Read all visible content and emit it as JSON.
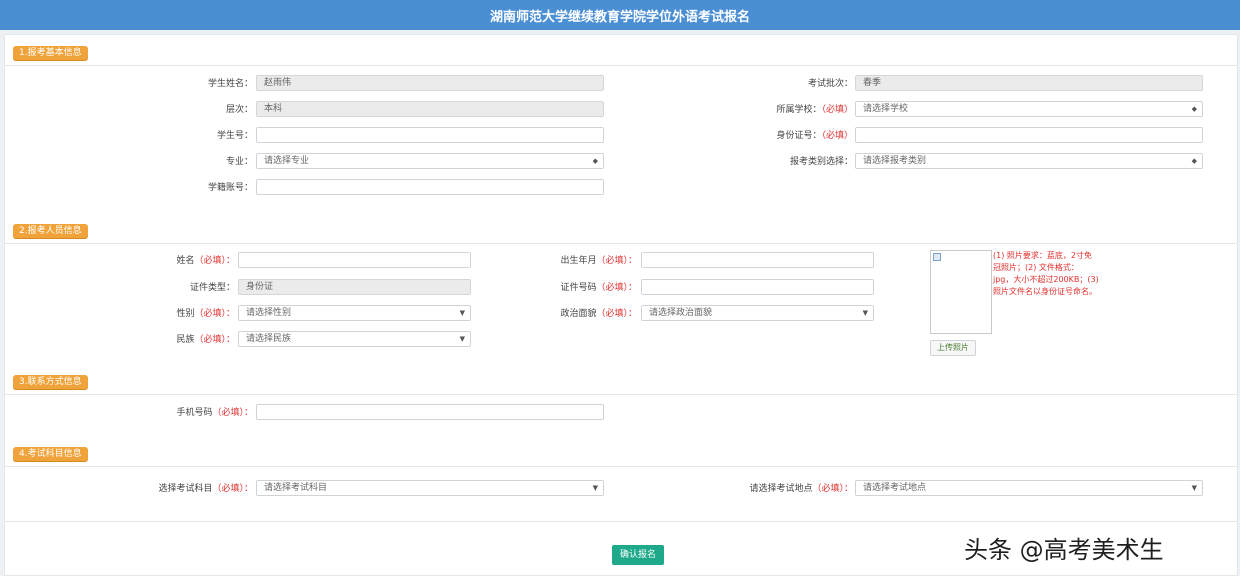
{
  "header": {
    "title": "湖南师范大学继续教育学院学位外语考试报名"
  },
  "sections": {
    "basic": "1.报考基本信息",
    "personal": "2.报考人员信息",
    "contact": "3.联系方式信息",
    "exam": "4.考试科目信息"
  },
  "basic_info": {
    "name_label": "学生姓名：",
    "name_value": "赵雨伟",
    "batch_label": "考试批次：",
    "batch_value": "春季",
    "level_label": "层次：",
    "level_value": "本科",
    "school_label": "所属学校：",
    "school_req": "（必填）",
    "school_value": "请选择学校",
    "student_no_label": "学生号：",
    "student_no_value": "",
    "id_label": "身份证号：",
    "id_req": "（必填）",
    "id_value": "",
    "major_label": "专业：",
    "major_value": "请选择专业",
    "category_label": "报考类别选择：",
    "category_value": "请选择报考类别",
    "account_label": "学籍账号：",
    "account_value": ""
  },
  "personal_info": {
    "surname_label": "姓名",
    "surname_req": "（必填）：",
    "surname_value": "",
    "birth_label": "出生年月",
    "birth_req": "（必填）：",
    "birth_value": "",
    "idtype_label": "证件类型：",
    "idtype_value": "身份证",
    "idno_label": "证件号码",
    "idno_req": "（必填）：",
    "idno_value": "",
    "gender_label": "性别",
    "gender_req": "（必填）：",
    "gender_value": "请选择性别",
    "nation_label": "政治面貌",
    "nation_req": "（必填）：",
    "nation_value": "请选择政治面貌",
    "ethnic_label": "民族",
    "ethnic_req": "（必填）：",
    "ethnic_value": "请选择民族",
    "upload_label": "上传照片",
    "photo_notes": "(1) 照片要求：蓝底，2寸免冠照片；(2) 文件格式：jpg，大小不超过200KB；(3) 照片文件名以身份证号命名。"
  },
  "contact_info": {
    "phone_label": "手机号码",
    "phone_req": "（必填）：",
    "phone_value": ""
  },
  "exam_info": {
    "subject_label": "选择考试科目",
    "subject_req": "（必填）：",
    "subject_value": "请选择考试科目",
    "site_label": "请选择考试地点",
    "site_req": "（必填）：",
    "site_value": "请选择考试地点"
  },
  "actions": {
    "submit": "确认报名"
  },
  "watermark": "头条 @高考美术生"
}
